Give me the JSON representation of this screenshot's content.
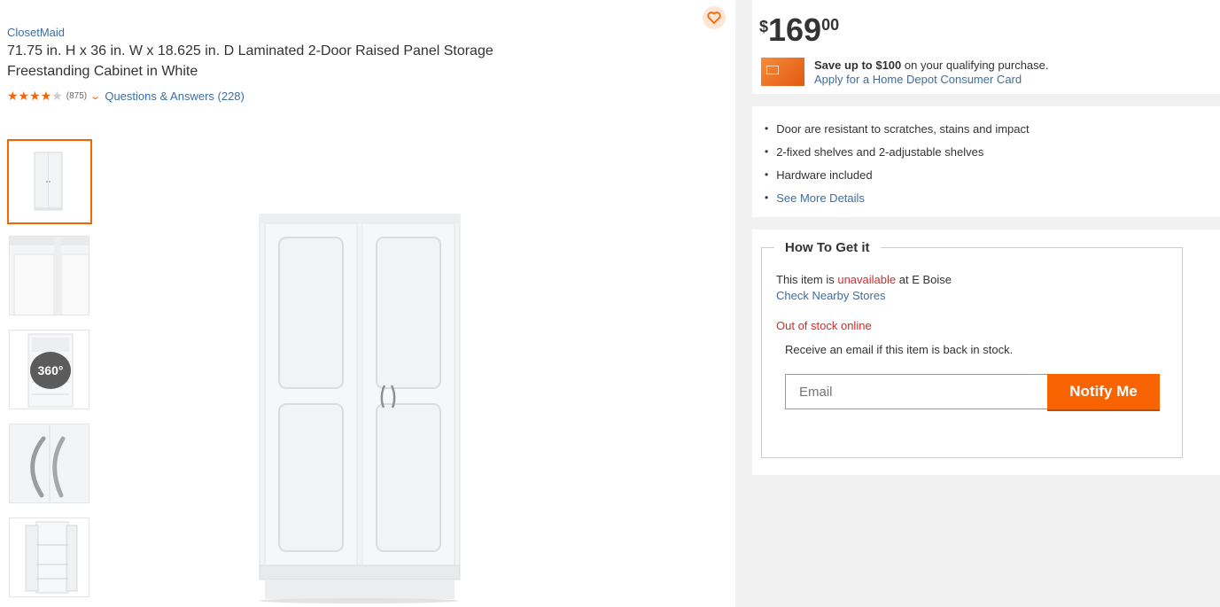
{
  "product": {
    "brand": "ClosetMaid",
    "title": "71.75 in. H x 36 in. W x 18.625 in. D Laminated 2-Door Raised Panel Storage Freestanding Cabinet in White",
    "rating_stars": "★★★★",
    "rating_empty_star": "★",
    "rating_value": 4,
    "review_count": "(875)",
    "qa_link": "Questions & Answers (228)"
  },
  "gallery": {
    "badge_360": "360°",
    "icons": [
      "heart-icon",
      "chevron-down-icon",
      "360-view-icon"
    ]
  },
  "price": {
    "symbol": "$",
    "dollars": "169",
    "cents": "00"
  },
  "promo": {
    "bold": "Save up to $100",
    "text": " on your qualifying purchase.",
    "link": "Apply for a Home Depot Consumer Card"
  },
  "highlights": {
    "items": [
      "Door are resistant to scratches, stains and impact",
      "2-fixed shelves and 2-adjustable shelves",
      "Hardware included"
    ],
    "more_link": "See More Details"
  },
  "fulfillment": {
    "heading": "How To Get it",
    "avail_prefix": "This item is ",
    "avail_status": "unavailable",
    "avail_suffix": " at E Boise",
    "nearby_link": "Check Nearby Stores",
    "online_status": "Out of stock online",
    "receive_text": "Receive an email if this item is back in stock.",
    "email_placeholder": "Email",
    "notify_label": "Notify Me"
  },
  "colors": {
    "accent": "#f96302",
    "link": "#3d6e9e",
    "alert": "#d12b2b",
    "panel_bg": "#f1f1f1"
  }
}
